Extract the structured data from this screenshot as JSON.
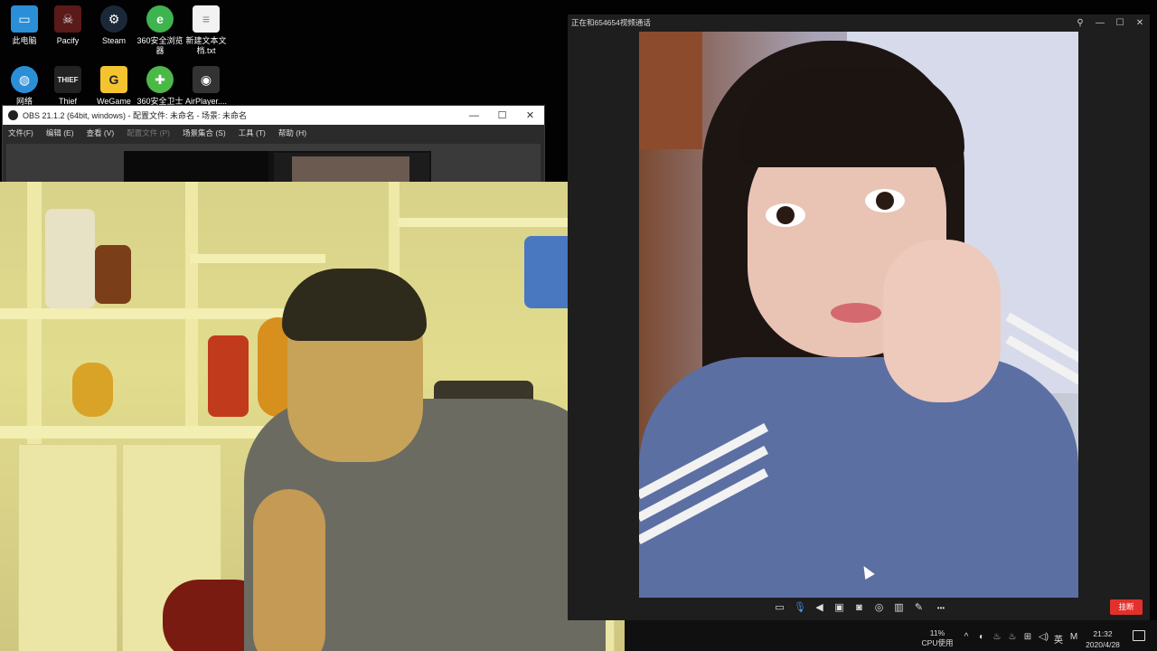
{
  "desktop": {
    "icons": [
      {
        "label": "此电脑",
        "icon": "computer-icon",
        "color": "#2b8fd8"
      },
      {
        "label": "Pacify",
        "icon": "pacify-game-icon",
        "color": "#5a1a1a"
      },
      {
        "label": "Steam",
        "icon": "steam-icon",
        "color": "#1b2838"
      },
      {
        "label": "360安全浏览器",
        "icon": "browser-360-icon",
        "color": "#3fb34f"
      },
      {
        "label": "新建文本文档.txt",
        "icon": "text-file-icon",
        "color": "#f2f2f2"
      },
      {
        "label": "网络",
        "icon": "network-icon",
        "color": "#2b8fd8"
      },
      {
        "label": "Thief",
        "icon": "thief-game-icon",
        "color": "#222222"
      },
      {
        "label": "WeGame",
        "icon": "wegame-icon",
        "color": "#f4c430"
      },
      {
        "label": "360安全卫士",
        "icon": "security-360-icon",
        "color": "#4cb848"
      },
      {
        "label": "AirPlayer....",
        "icon": "airplayer-icon",
        "color": "#333333"
      }
    ]
  },
  "obs": {
    "title": "OBS 21.1.2 (64bit, windows) - 配置文件: 未命名 - 场景: 未命名",
    "minimize": "—",
    "maximize": "☐",
    "close": "✕",
    "menu": [
      {
        "label": "文件(F)",
        "enabled": true
      },
      {
        "label": "编辑 (E)",
        "enabled": true
      },
      {
        "label": "查看 (V)",
        "enabled": true
      },
      {
        "label": "配置文件 (P)",
        "enabled": false
      },
      {
        "label": "场景集合 (S)",
        "enabled": true
      },
      {
        "label": "工具 (T)",
        "enabled": true
      },
      {
        "label": "帮助 (H)",
        "enabled": true
      }
    ]
  },
  "call": {
    "title": "正在和654654视频通话",
    "pin": "⚲",
    "minimize": "—",
    "maximize": "☐",
    "close": "✕",
    "hangup": "挂断",
    "tools": [
      {
        "icon": "chat-icon",
        "glyph": "▭"
      },
      {
        "icon": "microphone-icon",
        "glyph": "🎙"
      },
      {
        "icon": "speaker-icon",
        "glyph": "◀"
      },
      {
        "icon": "camera-off-icon",
        "glyph": "▣"
      },
      {
        "icon": "screenshot-icon",
        "glyph": "◙"
      },
      {
        "icon": "record-icon",
        "glyph": "◎"
      },
      {
        "icon": "layout-icon",
        "glyph": "▥"
      },
      {
        "icon": "edit-icon",
        "glyph": "✎"
      },
      {
        "icon": "more-icon",
        "glyph": "•••"
      }
    ],
    "accent": "#e2302b"
  },
  "taskbar": {
    "cpu_percent": "11%",
    "cpu_label": "CPU使用",
    "tray": [
      "^",
      "◐",
      "♨",
      "♨",
      "⊞",
      "◁)",
      "英",
      "M"
    ],
    "time": "21:32",
    "date": "2020/4/28"
  }
}
